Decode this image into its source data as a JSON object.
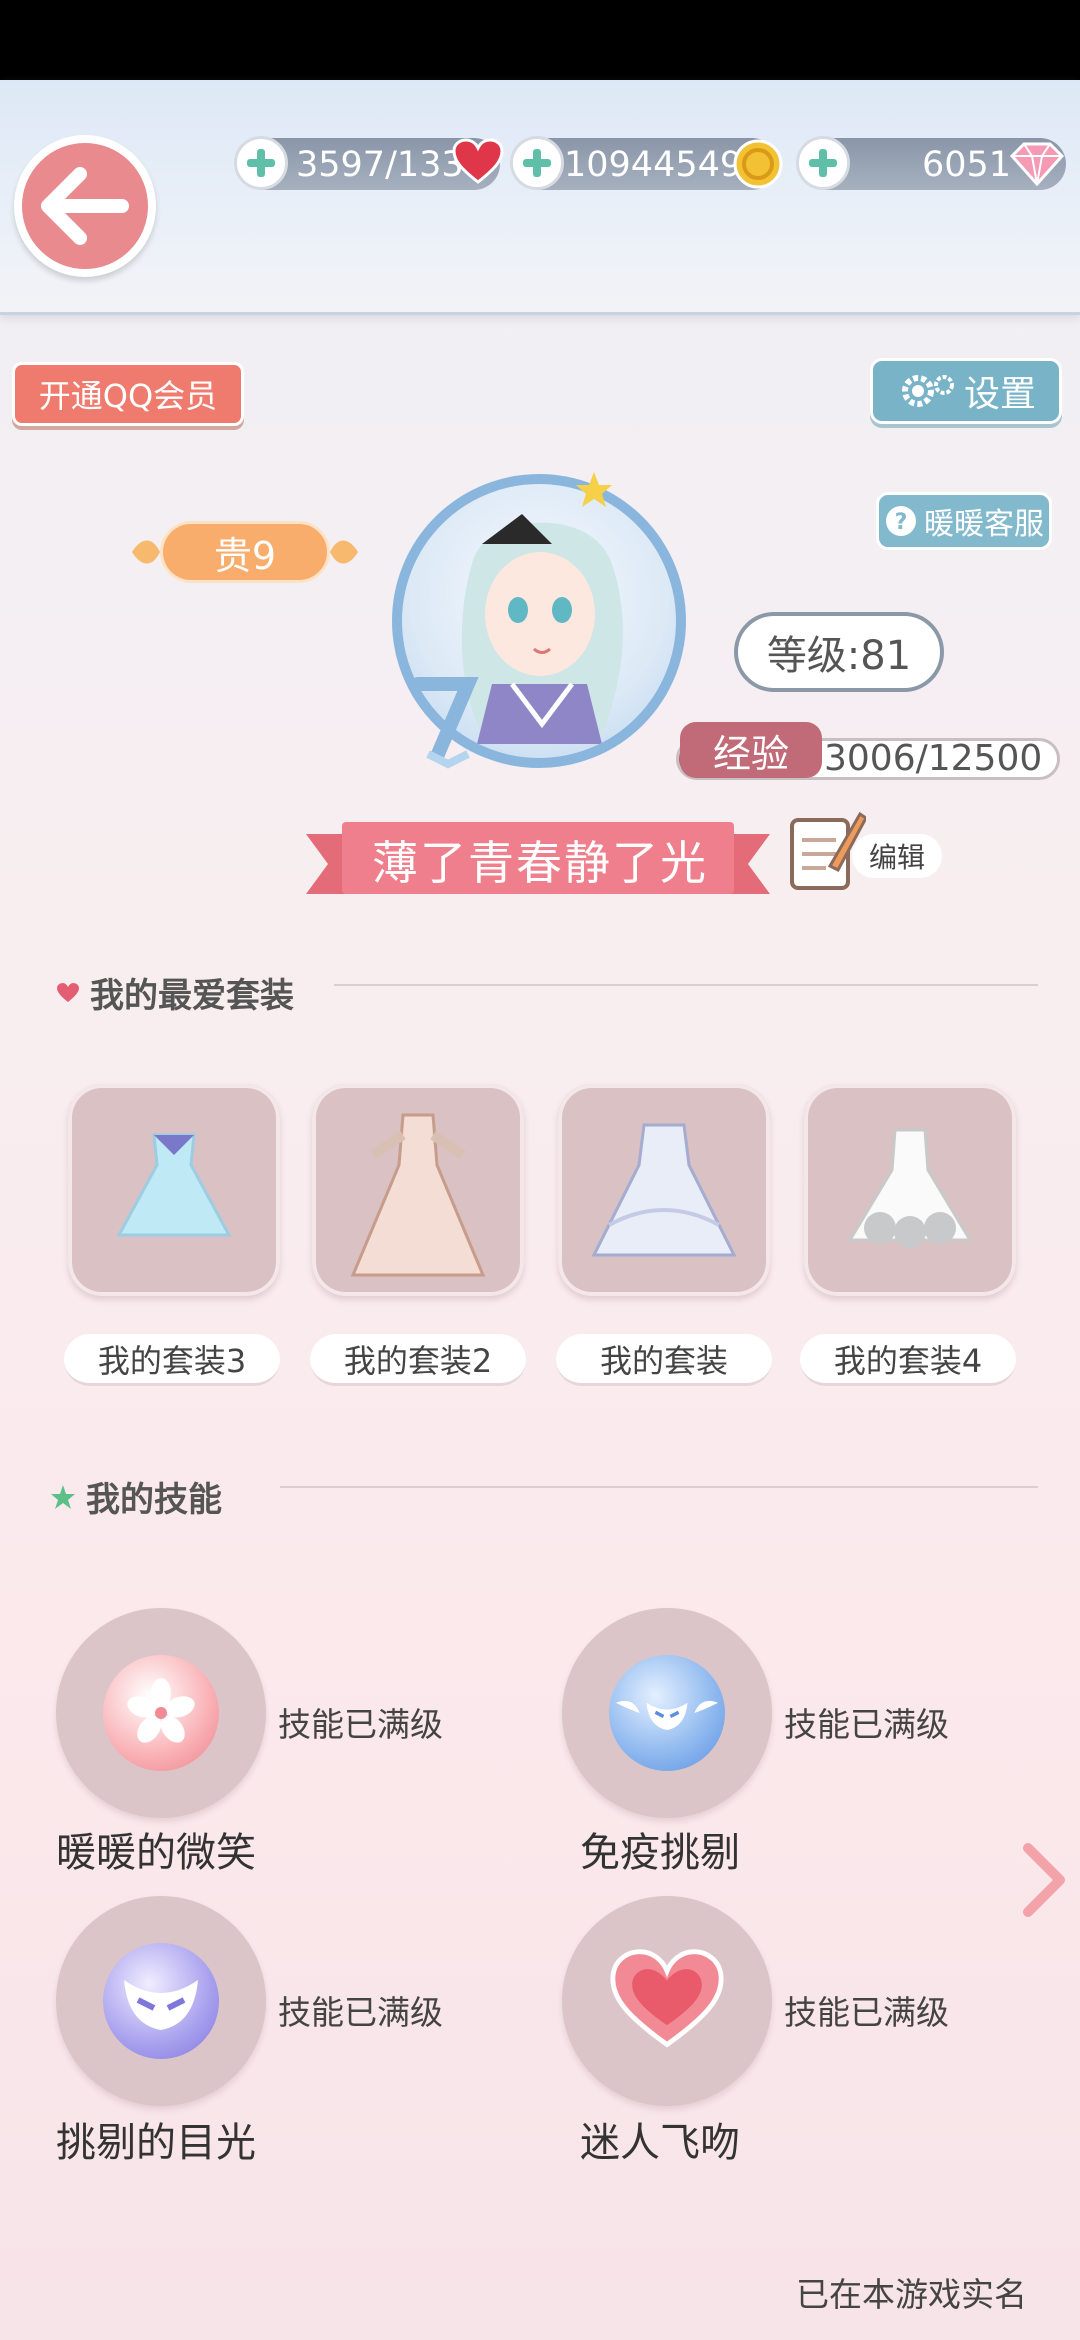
{
  "header": {
    "resources": [
      {
        "value": "3597/133",
        "icon": "heart-icon"
      },
      {
        "value": "10944549",
        "icon": "gold-coin-icon"
      },
      {
        "value": "6051",
        "icon": "diamond-icon"
      }
    ]
  },
  "buttons": {
    "qq_member": "开通QQ会员",
    "settings": "设置",
    "customer_service": "暖暖客服",
    "edit": "编辑"
  },
  "profile": {
    "vip": "贵9",
    "level": "等级:81",
    "exp_label": "经验",
    "exp_value": "3006/12500",
    "exp_progress": 0.2405,
    "name": "薄了青春静了光"
  },
  "favorites": {
    "title": "我的最爱套装",
    "suits": [
      {
        "label": "我的套装3"
      },
      {
        "label": "我的套装2"
      },
      {
        "label": "我的套装"
      },
      {
        "label": "我的套装4"
      }
    ]
  },
  "skills": {
    "title": "我的技能",
    "items": [
      {
        "name": "暖暖的微笑",
        "status": "技能已满级",
        "icon": "sakura-icon"
      },
      {
        "name": "免疫挑剔",
        "status": "技能已满级",
        "icon": "winged-mask-icon"
      },
      {
        "name": "挑剔的目光",
        "status": "技能已满级",
        "icon": "mask-icon"
      },
      {
        "name": "迷人飞吻",
        "status": "技能已满级",
        "icon": "heart-icon"
      }
    ]
  },
  "footer": {
    "realname": "已在本游戏实名"
  },
  "colors": {
    "accent_pink": "#ef7b6e",
    "accent_blue": "#78b3c8",
    "card_bg": "#d9c1c4"
  }
}
